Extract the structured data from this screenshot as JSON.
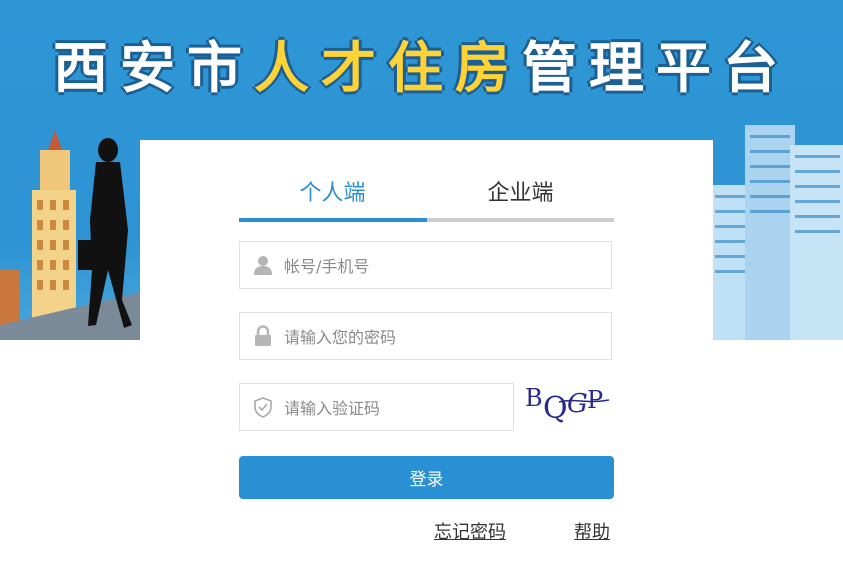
{
  "banner": {
    "title_part1": "西安市",
    "title_part2": "人才住房",
    "title_part3": "管理平台"
  },
  "tabs": [
    {
      "label": "个人端",
      "active": true
    },
    {
      "label": "企业端",
      "active": false
    }
  ],
  "form": {
    "account_placeholder": "帐号/手机号",
    "password_placeholder": "请输入您的密码",
    "captcha_placeholder": "请输入验证码",
    "captcha_text": "BQGP",
    "login_label": "登录"
  },
  "links": {
    "forgot": "忘记密码",
    "help": "帮助"
  },
  "colors": {
    "accent": "#2a90d4",
    "title_highlight": "#ffd235",
    "banner_bg": "#2f97d6"
  }
}
